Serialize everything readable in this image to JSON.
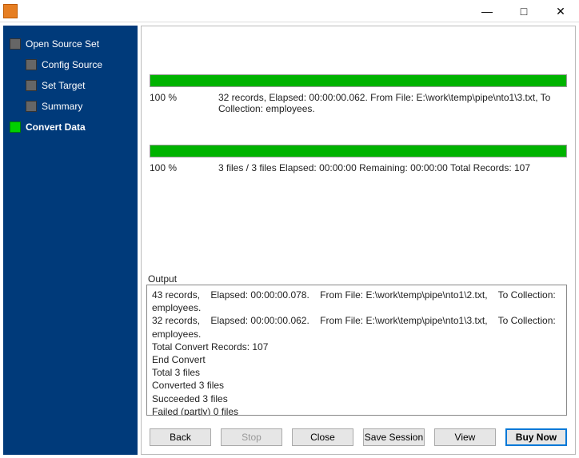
{
  "window": {
    "minimize": "—",
    "maximize": "□",
    "close": "✕"
  },
  "sidebar": {
    "steps": [
      {
        "label": "Open Source Set",
        "active": false,
        "child": false
      },
      {
        "label": "Config Source",
        "active": false,
        "child": true
      },
      {
        "label": "Set Target",
        "active": false,
        "child": true
      },
      {
        "label": "Summary",
        "active": false,
        "child": true
      },
      {
        "label": "Convert Data",
        "active": true,
        "child": false
      }
    ]
  },
  "progress": {
    "bar1": {
      "pct": "100 %",
      "detail": "32 records,    Elapsed: 00:00:00.062.    From File: E:\\work\\temp\\pipe\\nto1\\3.txt,    To Collection: employees."
    },
    "bar2": {
      "pct": "100 %",
      "detail": "3 files / 3 files    Elapsed: 00:00:00    Remaining: 00:00:00    Total Records: 107"
    }
  },
  "output": {
    "label": "Output",
    "lines": [
      "43 records,    Elapsed: 00:00:00.078.    From File: E:\\work\\temp\\pipe\\nto1\\2.txt,    To Collection: employees.",
      "32 records,    Elapsed: 00:00:00.062.    From File: E:\\work\\temp\\pipe\\nto1\\3.txt,    To Collection: employees.",
      "Total Convert Records: 107",
      "End Convert",
      "Total 3 files",
      "Converted 3 files",
      "Succeeded 3 files",
      "Failed (partly) 0 files"
    ]
  },
  "buttons": {
    "back": "Back",
    "stop": "Stop",
    "close": "Close",
    "save_session": "Save Session",
    "view": "View",
    "buy_now": "Buy Now"
  }
}
